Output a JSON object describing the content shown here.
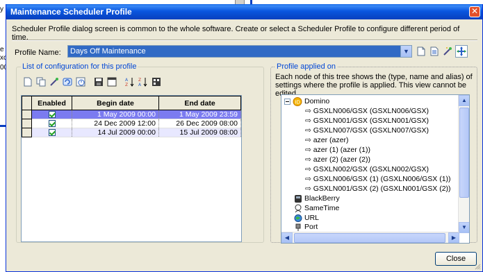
{
  "background": {
    "snippets": [
      "y",
      "e",
      "xc",
      "00"
    ]
  },
  "dialog": {
    "title": "Maintenance Scheduler Profile",
    "close_glyph": "✕",
    "description": "Scheduler Profile dialog screen is common to the whole software.  Create or select a Scheduler Profile to configure different period of time.",
    "profile_label": "Profile Name:",
    "profile_value": "Days Off Maintenance",
    "close_button": "Close"
  },
  "config_group": {
    "title": "List of configuration for this profile",
    "columns": [
      "Enabled",
      "Begin date",
      "End date"
    ],
    "rows": [
      {
        "enabled": true,
        "begin": "1 May 2009 00:00",
        "end": "1 May 2009 23:59"
      },
      {
        "enabled": true,
        "begin": "24 Dec 2009 12:00",
        "end": "26 Dec 2009 08:00"
      },
      {
        "enabled": true,
        "begin": "14 Jul 2009 00:00",
        "end": "15 Jul 2009 08:00"
      }
    ]
  },
  "applied_group": {
    "title": "Profile applied on",
    "description": "Each node of this tree shows the (type, name and alias) of settings where the profile is applied. This view cannot be edited,",
    "tree": {
      "root": "Domino",
      "children": [
        "GSXLN006/GSX (GSXLN006/GSX)",
        "GSXLN001/GSX (GSXLN001/GSX)",
        "GSXLN007/GSX (GSXLN007/GSX)",
        "azer (azer)",
        "azer (1) (azer (1))",
        "azer (2) (azer (2))",
        "GSXLN002/GSX (GSXLN002/GSX)",
        "GSXLN006/GSX (1) (GSXLN006/GSX (1))",
        "GSXLN001/GSX (2) (GSXLN001/GSX (2))"
      ],
      "others": [
        "BlackBerry",
        "SameTime",
        "URL",
        "Port"
      ]
    }
  },
  "colors": {
    "title_blue": "#0a56e0",
    "selection": "#7b7bf0",
    "group_title": "#0046d5",
    "dialog_bg": "#ece9d8"
  }
}
